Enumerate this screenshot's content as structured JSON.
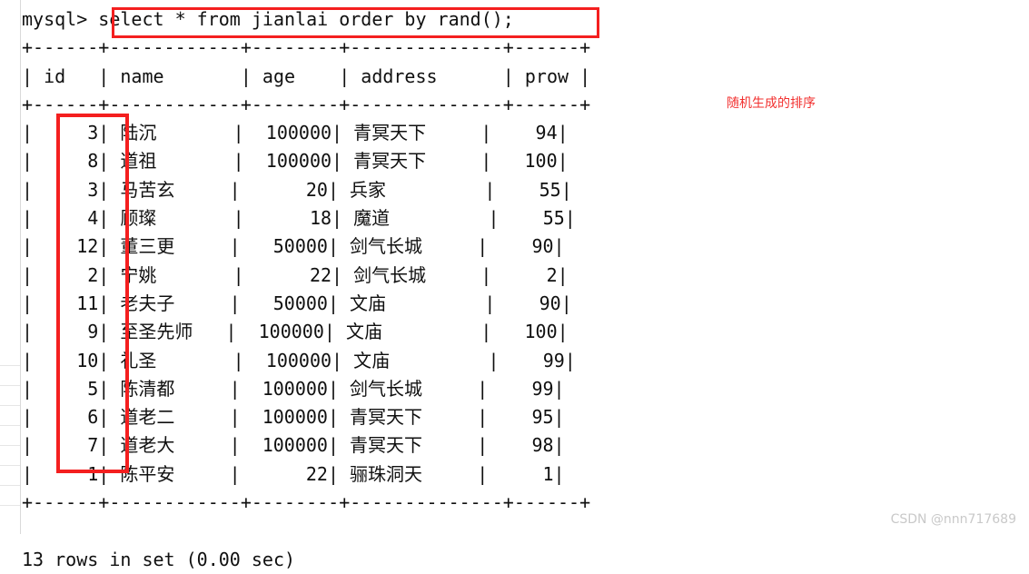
{
  "terminal": {
    "prompt": "mysql>",
    "query": "select * from jianlai order by rand();",
    "status_line": "13 rows in set (0.00 sec)"
  },
  "table": {
    "rule_top": "+------+------------+--------+--------------+------+",
    "rule_mid": "+------+------------+--------+--------------+------+",
    "rule_bottom": "+------+------------+--------+--------------+------+",
    "columns": [
      "id",
      "name",
      "age",
      "address",
      "prow"
    ],
    "header_line": "| id   | name       | age    | address      | prow |",
    "rows": [
      {
        "id": "3",
        "name": "陆沉",
        "age": "100000",
        "address": "青冥天下",
        "prow": "94"
      },
      {
        "id": "8",
        "name": "道祖",
        "age": "100000",
        "address": "青冥天下",
        "prow": "100"
      },
      {
        "id": "3",
        "name": "马苦玄",
        "age": "20",
        "address": "兵家",
        "prow": "55"
      },
      {
        "id": "4",
        "name": "顾璨",
        "age": "18",
        "address": "魔道",
        "prow": "55"
      },
      {
        "id": "12",
        "name": "董三更",
        "age": "50000",
        "address": "剑气长城",
        "prow": "90"
      },
      {
        "id": "2",
        "name": "宁姚",
        "age": "22",
        "address": "剑气长城",
        "prow": "2"
      },
      {
        "id": "11",
        "name": "老夫子",
        "age": "50000",
        "address": "文庙",
        "prow": "90"
      },
      {
        "id": "9",
        "name": "至圣先师",
        "age": "100000",
        "address": "文庙",
        "prow": "100"
      },
      {
        "id": "10",
        "name": "礼圣",
        "age": "100000",
        "address": "文庙",
        "prow": "99"
      },
      {
        "id": "5",
        "name": "陈清都",
        "age": "100000",
        "address": "剑气长城",
        "prow": "99"
      },
      {
        "id": "6",
        "name": "道老二",
        "age": "100000",
        "address": "青冥天下",
        "prow": "95"
      },
      {
        "id": "7",
        "name": "道老大",
        "age": "100000",
        "address": "青冥天下",
        "prow": "98"
      },
      {
        "id": "1",
        "name": "陈平安",
        "age": "22",
        "address": "骊珠洞天",
        "prow": "1"
      }
    ]
  },
  "annotations": {
    "side_note": "随机生成的排序",
    "highlight_color": "#f41f1f",
    "note_color": "#f2302f"
  },
  "watermark": {
    "text": "CSDN @nnn717689"
  }
}
